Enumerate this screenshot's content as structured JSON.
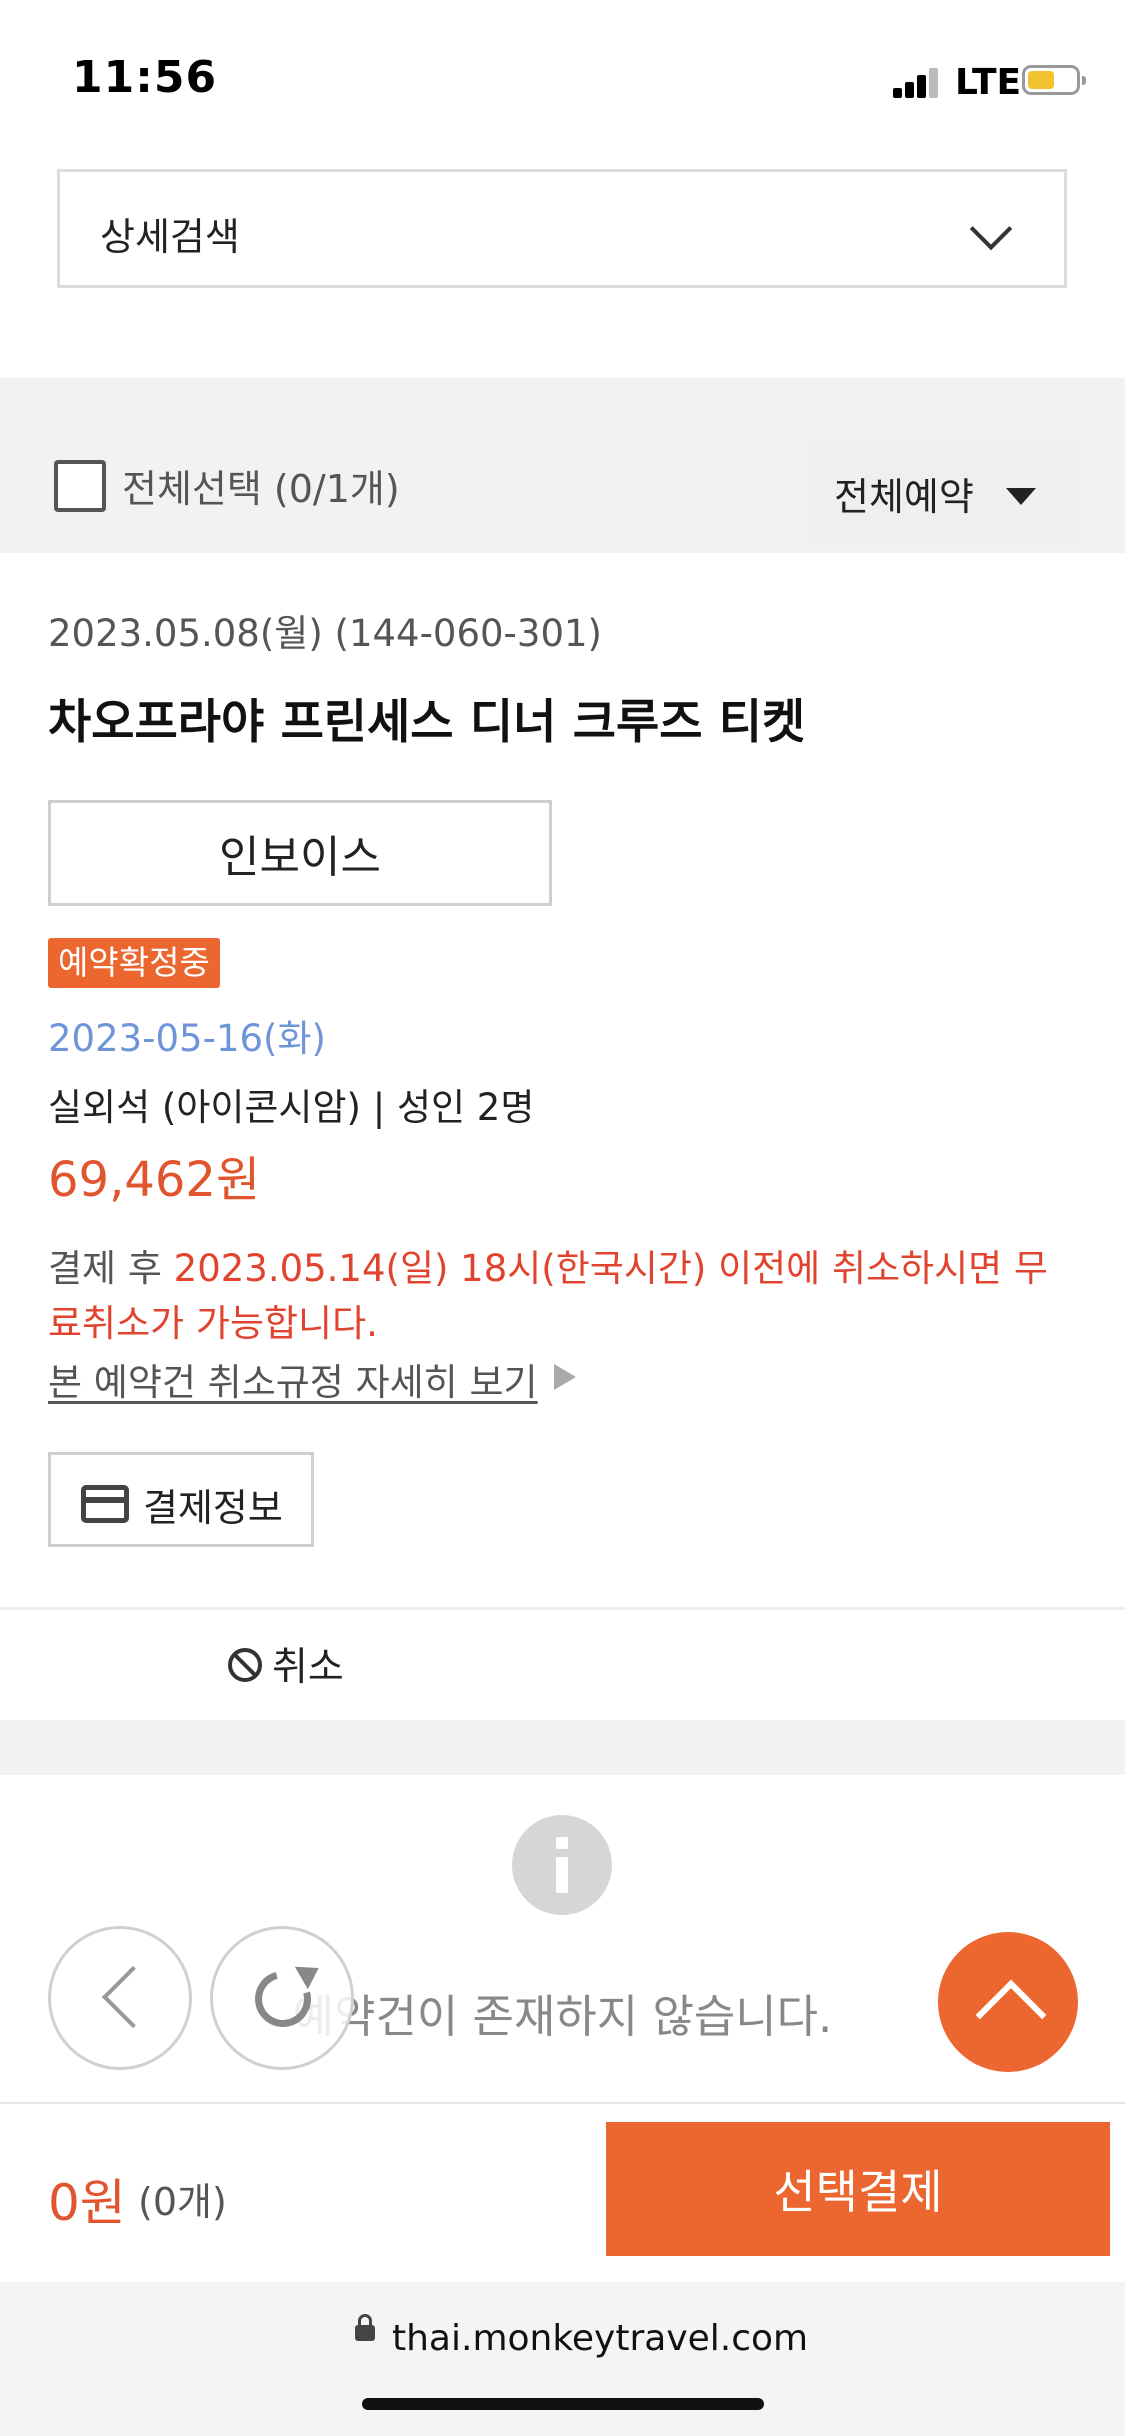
{
  "status_bar": {
    "time": "11:56",
    "network": "LTE",
    "battery_color": "#f2c230"
  },
  "search": {
    "label": "상세검색",
    "icon": "chevron-down-icon"
  },
  "toolbar": {
    "select_all_label": "전체선택 (0/1개)",
    "filter_label": "전체예약"
  },
  "booking": {
    "meta": "2023.05.08(월) (144-060-301)",
    "title": "차오프라야 프린세스 디너 크루즈 티켓",
    "invoice_label": "인보이스",
    "status": "예약확정중",
    "use_date": "2023-05-16(화)",
    "option": "실외석 (아이콘시암) | 성인 2명",
    "price": "69,462원",
    "policy_prefix": "결제 후 ",
    "policy_highlight": "2023.05.14(일) 18시(한국시간) 이전에 취소하시면 무료취소가 가능합니다.",
    "policy_link": "본 예약건 취소규정 자세히 보기",
    "payment_info_label": "결제정보",
    "cancel_label": "취소"
  },
  "empty_state": {
    "message": "예약건이 존재하지 않습니다."
  },
  "bottom_bar": {
    "total_amount": "0원",
    "total_count": "(0개)",
    "checkout_label": "선택결제"
  },
  "browser": {
    "url": "thai.monkeytravel.com"
  },
  "colors": {
    "accent": "#ec6630",
    "price": "#e0552e",
    "date": "#6f95d9",
    "policy_red": "#e0442e"
  }
}
